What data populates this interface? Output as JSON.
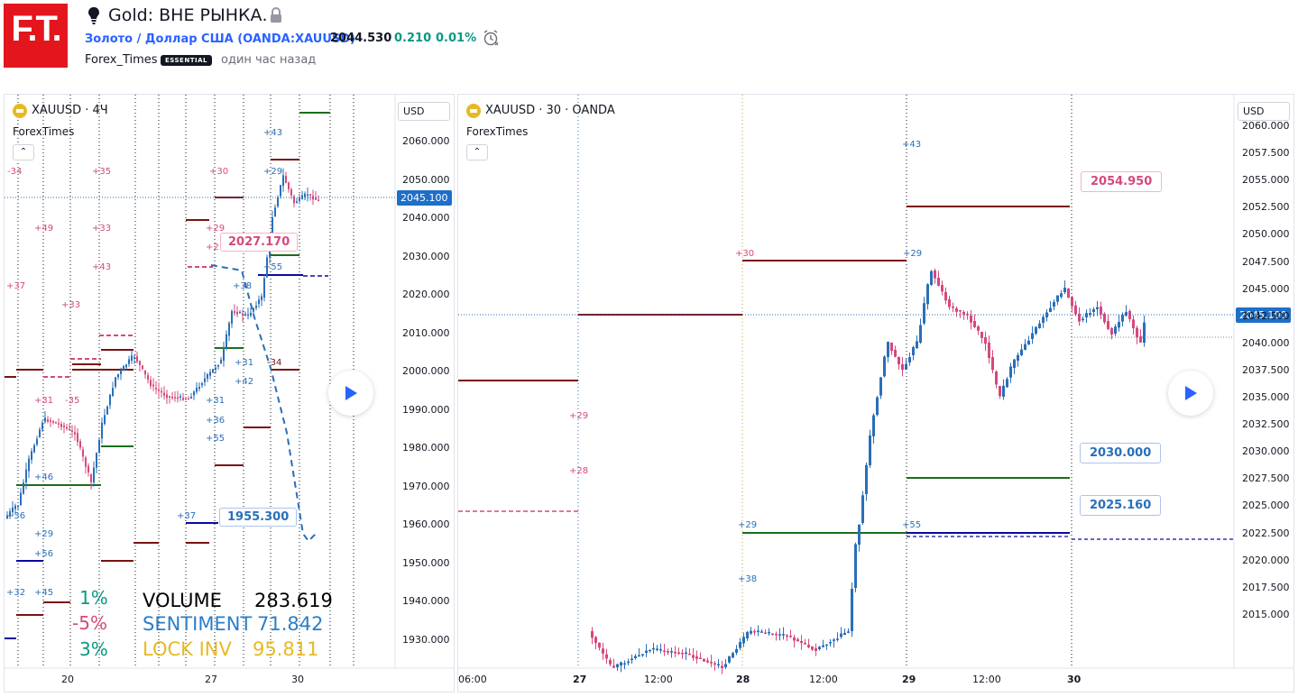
{
  "header": {
    "title": "Gold: ВНЕ РЫНКА.",
    "logo_text": "F.T.",
    "symbol_link": "Золото / Доллар США (OANDA:XAUUSD)",
    "price": "2044.530",
    "change": "0.210",
    "change_pct": "0.01%",
    "author": "Forex_Times",
    "badge": "ESSENTIAL",
    "time_ago": "один час назад"
  },
  "left_chart": {
    "legend_title": "XAUUSD · 4Ч",
    "legend_sub": "ForexTimes",
    "currency_button": "USD",
    "price_ticks": [
      "2060.000",
      "2050.000",
      "2040.000",
      "2030.000",
      "2020.000",
      "2010.000",
      "2000.000",
      "1990.000",
      "1980.000",
      "1970.000",
      "1960.000",
      "1950.000",
      "1940.000",
      "1930.000"
    ],
    "last_price_tag": "2045.100",
    "date_ticks": [
      "20",
      "27",
      "30"
    ],
    "callouts": [
      "2027.170",
      "1955.300"
    ],
    "stats": {
      "pct": [
        "1%",
        "-5%",
        "3%"
      ],
      "volume_label": "VOLUME",
      "volume_value": "283.619",
      "sentiment_label": "SENTIMENT",
      "sentiment_value": "71.842",
      "lock_label": "LOCK INV",
      "lock_value": "95.811"
    },
    "markers": [
      "-34",
      "+35",
      "+49",
      "+33",
      "+43",
      "+37",
      "+33",
      "+31",
      "-35",
      "+46",
      "+29",
      "+56",
      "+32",
      "+45",
      "+36",
      "+30",
      "+29",
      "+29",
      "+2",
      "+43",
      "+55",
      "+38",
      "+31",
      "+42",
      "+31",
      "+36",
      "+55",
      "-34",
      "+37"
    ]
  },
  "right_chart": {
    "legend_title": "XAUUSD · 30 · OANDA",
    "legend_sub": "ForexTimes",
    "currency_button": "USD",
    "price_ticks": [
      "2060.000",
      "2057.500",
      "2055.000",
      "2052.500",
      "2050.000",
      "2047.500",
      "2045.000",
      "2042.500",
      "2040.000",
      "2037.500",
      "2035.000",
      "2032.500",
      "2030.000",
      "2027.500",
      "2025.000",
      "2022.500",
      "2020.000",
      "2017.500",
      "2015.000"
    ],
    "last_price_tag": "2045.100",
    "date_ticks": [
      "06:00",
      "27",
      "12:00",
      "28",
      "12:00",
      "29",
      "12:00",
      "30"
    ],
    "callouts": [
      "2054.950",
      "2030.000",
      "2025.160"
    ],
    "markers": [
      "+43",
      "+30",
      "+29",
      "+29",
      "+28",
      "+29",
      "+55",
      "+38"
    ]
  },
  "colors": {
    "up": "#2a6fb8",
    "down": "#d6487e",
    "resistance": "#7a1212",
    "support": "#1b6e1b",
    "pivot": "#0a0aa0",
    "accent_blue": "#2962ff",
    "green": "#089981",
    "red": "#e3161d",
    "gold": "#e8b923",
    "sentiment": "#2a7ec9"
  },
  "icons": [
    "bulb-icon",
    "lock-icon",
    "alarm-clock-icon",
    "play-icon",
    "chevron-up-icon",
    "gold-coin-icon"
  ]
}
